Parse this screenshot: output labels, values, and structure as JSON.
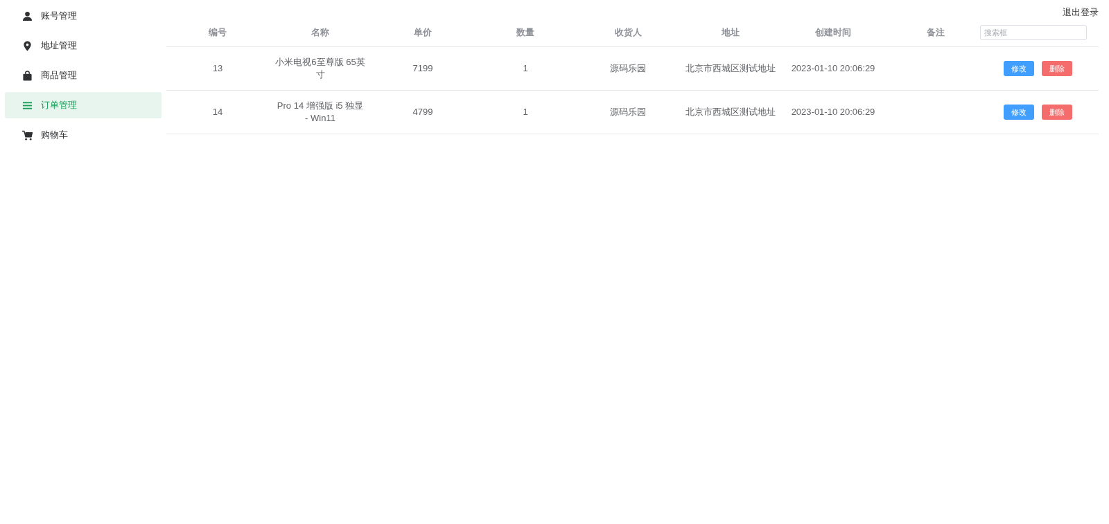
{
  "sidebar": {
    "items": [
      {
        "label": "账号管理",
        "selected": false
      },
      {
        "label": "地址管理",
        "selected": false
      },
      {
        "label": "商品管理",
        "selected": false
      },
      {
        "label": "订单管理",
        "selected": true
      },
      {
        "label": "购物车",
        "selected": false
      }
    ]
  },
  "header": {
    "logout": "退出登录"
  },
  "table": {
    "columns": [
      "编号",
      "名称",
      "单价",
      "数量",
      "收货人",
      "地址",
      "创建时间",
      "备注"
    ],
    "search": {
      "placeholder": "搜索框"
    },
    "rows": [
      {
        "cells": [
          "13",
          "小米电视6至尊版 65英寸",
          "7199",
          "1",
          "源码乐园",
          "北京市西城区测试地址",
          "2023-01-10 20:06:29",
          ""
        ],
        "actions": [
          "修改",
          "删除"
        ]
      },
      {
        "cells": [
          "14",
          "Pro 14 增强版 i5 独显 - Win11",
          "4799",
          "1",
          "源码乐园",
          "北京市西城区测试地址",
          "2023-01-10 20:06:29",
          ""
        ],
        "actions": [
          "修改",
          "删除"
        ]
      }
    ]
  }
}
